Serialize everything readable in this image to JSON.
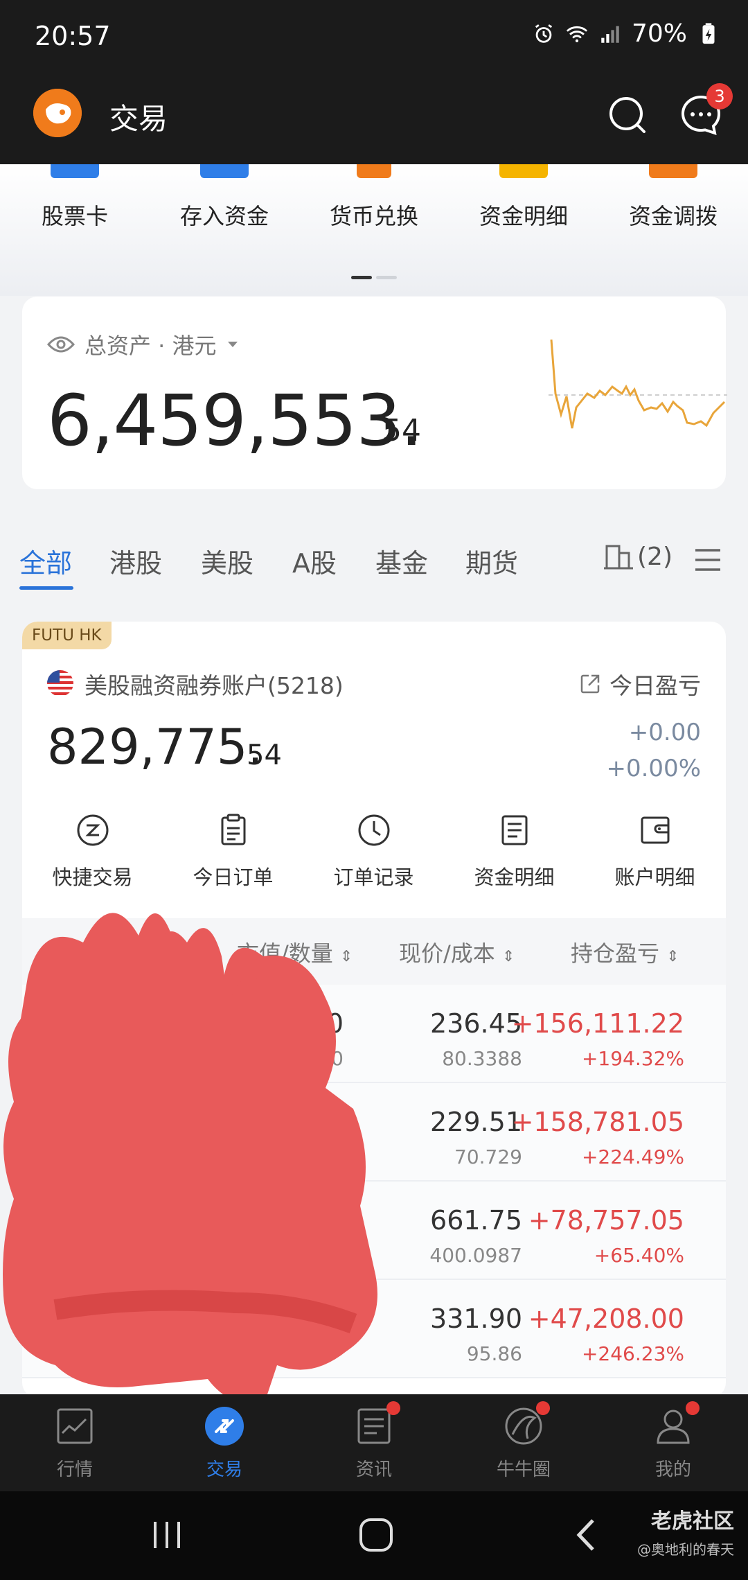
{
  "status_bar": {
    "time": "20:57",
    "battery": "70%"
  },
  "app_bar": {
    "title": "交易",
    "message_badge": "3"
  },
  "shortcuts": [
    {
      "label": "股票卡",
      "color": "#2f7ee8"
    },
    {
      "label": "存入资金",
      "color": "#2f7ee8"
    },
    {
      "label": "货币兑换",
      "color": "#f07b1b"
    },
    {
      "label": "资金明细",
      "color": "#f5b400"
    },
    {
      "label": "资金调拨",
      "color": "#f07b1b"
    }
  ],
  "total_assets": {
    "label": "总资产 · 港元",
    "integer_part": "6,459,553.",
    "decimal_part": "54"
  },
  "market_tabs": {
    "items": [
      "全部",
      "港股",
      "美股",
      "A股",
      "基金",
      "期货"
    ],
    "active": "全部",
    "accounts_count": "(2)"
  },
  "account": {
    "broker_tag": "FUTU HK",
    "name": "美股融资融券账户(5218)",
    "today_pnl_label": "今日盈亏",
    "integer_part": "829,775.",
    "decimal_part": "54",
    "today_pnl": "+0.00",
    "today_pnl_pct": "+0.00%",
    "actions": [
      {
        "label": "快捷交易",
        "icon": "quick-trade-icon"
      },
      {
        "label": "今日订单",
        "icon": "clipboard-icon"
      },
      {
        "label": "订单记录",
        "icon": "clock-icon"
      },
      {
        "label": "资金明细",
        "icon": "document-icon"
      },
      {
        "label": "账户明细",
        "icon": "wallet-icon"
      }
    ],
    "table_headers": {
      "market_value": "市值/数量",
      "price_cost": "现价/成本",
      "position_pnl": "持仓盈亏"
    },
    "positions": [
      {
        "market_value_partial": "00",
        "quantity_partial": "00",
        "price": "236.45",
        "cost": "80.3388",
        "pnl": "+156,111.22",
        "pnl_pct": "+194.32%"
      },
      {
        "market_value_partial": "0",
        "quantity_partial": "",
        "price": "229.51",
        "cost": "70.729",
        "pnl": "+158,781.05",
        "pnl_pct": "+224.49%"
      },
      {
        "market_value_partial": "",
        "quantity_partial": "",
        "price": "661.75",
        "cost": "400.0987",
        "pnl": "+78,757.05",
        "pnl_pct": "+65.40%"
      },
      {
        "market_value_partial": "",
        "quantity_partial": "",
        "price": "331.90",
        "cost": "95.86",
        "pnl": "+47,208.00",
        "pnl_pct": "+246.23%"
      }
    ]
  },
  "bottom_nav": {
    "items": [
      {
        "label": "行情",
        "icon": "chart-icon"
      },
      {
        "label": "交易",
        "icon": "trade-icon"
      },
      {
        "label": "资讯",
        "icon": "news-icon"
      },
      {
        "label": "牛牛圈",
        "icon": "circle-icon"
      },
      {
        "label": "我的",
        "icon": "profile-icon"
      }
    ],
    "active": "交易"
  },
  "watermark": {
    "brand": "老虎社区",
    "user": "@奥地利的春天"
  },
  "colors": {
    "accent": "#2a73d9",
    "positive": "#e04a4a",
    "header_bg": "#1b1b1b"
  }
}
